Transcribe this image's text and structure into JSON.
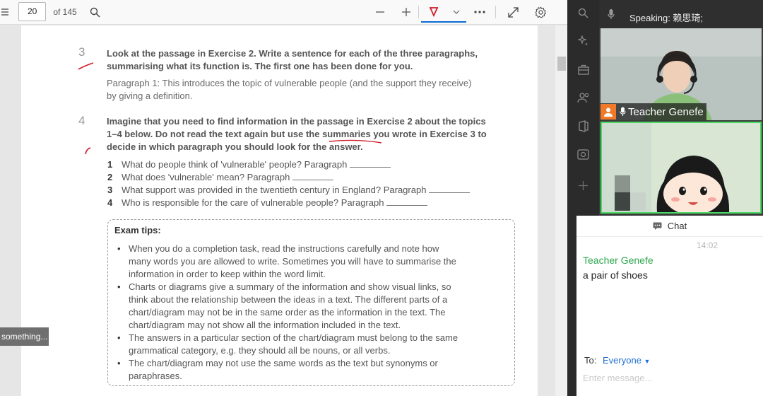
{
  "pdf": {
    "toolbar": {
      "menu_icon": "hamburger-icon",
      "page_number": "20",
      "page_total": "of 145",
      "search_icon": "search-icon",
      "zoom_out_icon": "minus-icon",
      "zoom_in_icon": "plus-icon",
      "draw_icon": "draw-pen-icon",
      "dropdown_icon": "chevron-down-icon",
      "more_icon": "more-icon",
      "fit_icon": "expand-icon",
      "settings_icon": "gear-icon"
    },
    "exercise3": {
      "number": "3",
      "instruction_line1": "Look at the passage in Exercise 2. Write a sentence for each of the three paragraphs,",
      "instruction_line2": "summarising what its function is. The first one has been done for you.",
      "example_line1": "Paragraph 1: This introduces the topic of vulnerable people (and the support they receive)",
      "example_line2": "by giving a definition."
    },
    "exercise4": {
      "number": "4",
      "instruction_line1": "Imagine that you need to find information in the passage in Exercise 2 about the topics",
      "instruction_line2_pre": "1–4 below. Do not read the text again but use the ",
      "instruction_line2_em": "summaries",
      "instruction_line2_post": " you wrote in Exercise 3 to",
      "instruction_line3": "decide in which paragraph you should look for the answer.",
      "questions": [
        {
          "num": "1",
          "text": "What do people think of 'vulnerable' people? Paragraph"
        },
        {
          "num": "2",
          "text": "What does 'vulnerable' mean? Paragraph"
        },
        {
          "num": "3",
          "text": "What support was provided in the twentieth century in England? Paragraph"
        },
        {
          "num": "4",
          "text": "Who is responsible for the care of vulnerable people? Paragraph"
        }
      ]
    },
    "tips": {
      "title": "Exam tips:",
      "items": [
        [
          "When you do a completion task, read the instructions carefully and note how",
          "many words you are allowed to write. Sometimes you will have to summarise the",
          "information in order to keep within the word limit."
        ],
        [
          "Charts or diagrams give a summary of the information and show visual links, so",
          "think about the relationship between the ideas in a text. The different parts of a",
          "chart/diagram may not be in the same order as the information in the text. The",
          "chart/diagram may not show all the information included in the text."
        ],
        [
          "The answers in a particular section of the chart/diagram must belong to the same",
          "grammatical category, e.g. they should all be nouns, or all verbs."
        ],
        [
          "The chart/diagram may not use the same words as the text but synonyms or",
          "paraphrases."
        ]
      ]
    },
    "tooltip": "something..."
  },
  "sidebar": {
    "icons": [
      "search-icon",
      "sparkle-icon",
      "briefcase-icon",
      "people-icon",
      "office-icon",
      "camera-doc-icon",
      "add-icon"
    ]
  },
  "meeting": {
    "speaking_label": "Speaking: 赖思琦;",
    "participant1_name": "Teacher Genefe"
  },
  "chat": {
    "title": "Chat",
    "time": "14:02",
    "sender": "Teacher Genefe",
    "message": "a pair of shoes",
    "to_label": "To:",
    "to_value": "Everyone",
    "placeholder": "Enter message..."
  },
  "colors": {
    "accent_blue": "#1f6fd1",
    "chat_sender_green": "#2ca64c",
    "annotation_red": "#d0202a",
    "host_orange": "#f07a2a"
  }
}
